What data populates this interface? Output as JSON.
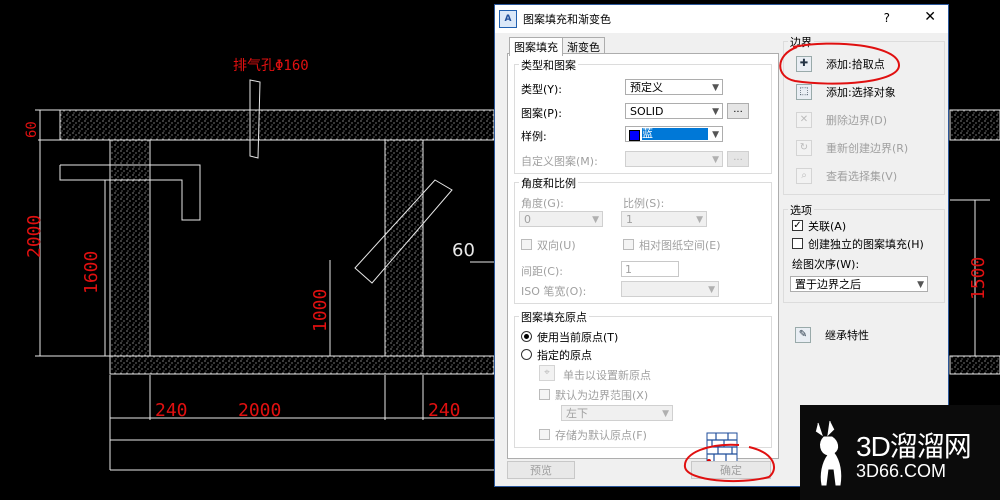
{
  "cad": {
    "label_exhaust": "排气孔Φ160",
    "dim_60_left": "60",
    "dim_2000_left": "2000",
    "dim_1600": "1600",
    "dim_1000": "1000",
    "dim_60_diag": "60",
    "dim_240_a": "240",
    "dim_2000_bottom": "2000",
    "dim_240_b": "240",
    "dim_1500": "1500",
    "colors": {
      "line": "#e8e8e8",
      "dim_text": "#e01010",
      "accent_ellipse": "#e01010"
    }
  },
  "dialog": {
    "title": "图案填充和渐变色",
    "help_glyph": "?",
    "close_glyph": "✕",
    "tabs": [
      {
        "label": "图案填充"
      },
      {
        "label": "渐变色"
      }
    ],
    "pattern_group": {
      "title": "类型和图案",
      "type_label": "类型(Y):",
      "type_value": "预定义",
      "pattern_label": "图案(P):",
      "pattern_value": "SOLID",
      "browse_label": "...",
      "sample_label": "样例:",
      "sample_value": "蓝",
      "custom_label": "自定义图案(M):",
      "custom_browse": "..."
    },
    "angle_group": {
      "title": "角度和比例",
      "angle_label": "角度(G):",
      "angle_value": "0",
      "scale_label": "比例(S):",
      "scale_value": "1",
      "double_label": "双向(U)",
      "relative_label": "相对图纸空间(E)",
      "spacing_label": "间距(C):",
      "spacing_value": "1",
      "iso_label": "ISO 笔宽(O):"
    },
    "origin_group": {
      "title": "图案填充原点",
      "use_current": "使用当前原点(T)",
      "specified": "指定的原点",
      "click_set": "单击以设置新原点",
      "default_extent": "默认为边界范围(X)",
      "extent_value": "左下",
      "store_default": "存储为默认原点(F)"
    },
    "boundary": {
      "title": "边界",
      "add_pick": "添加:拾取点",
      "add_select": "添加:选择对象",
      "remove": "删除边界(D)",
      "recreate": "重新创建边界(R)",
      "view": "查看选择集(V)"
    },
    "options": {
      "title": "选项",
      "associative": "关联(A)",
      "separate": "创建独立的图案填充(H)",
      "draw_order_label": "绘图次序(W):",
      "draw_order_value": "置于边界之后"
    },
    "inherit": "继承特性",
    "preview": "预览",
    "ok": "确定"
  },
  "watermark": {
    "big": "3D溜溜网",
    "small": "3D66.COM"
  }
}
